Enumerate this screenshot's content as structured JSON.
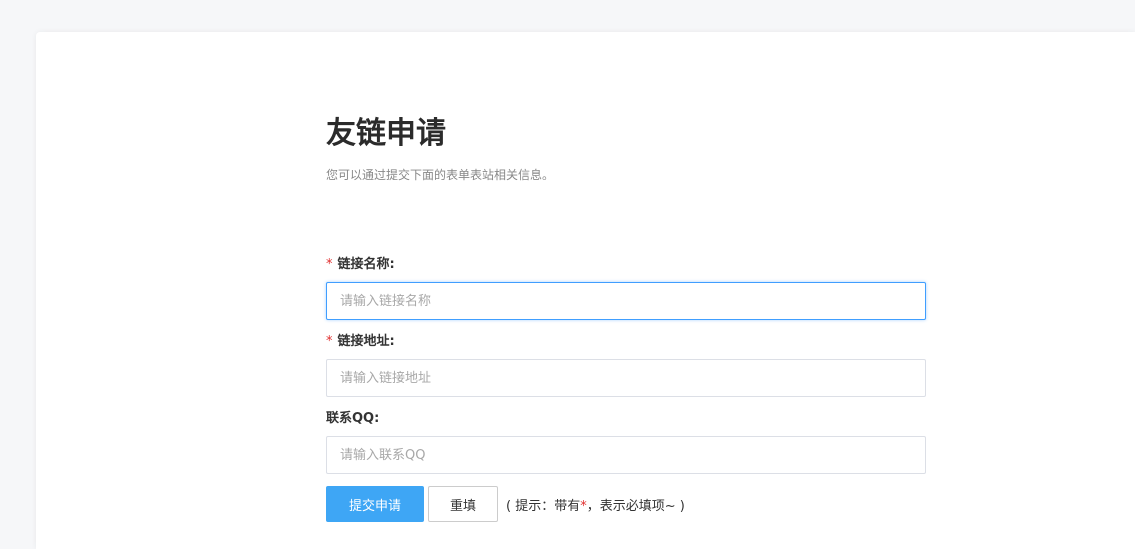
{
  "page": {
    "title": "友链申请",
    "subtitle": "您可以通过提交下面的表单表站相关信息。"
  },
  "form": {
    "required_mark": "*",
    "fields": [
      {
        "label": "链接名称:",
        "placeholder": "请输入链接名称",
        "value": "",
        "required": true
      },
      {
        "label": "链接地址:",
        "placeholder": "请输入链接地址",
        "value": "",
        "required": true
      },
      {
        "label": "联系QQ:",
        "placeholder": "请输入联系QQ",
        "value": "",
        "required": false
      }
    ],
    "submit_label": "提交申请",
    "reset_label": "重填",
    "hint_before": "( 提示：带有",
    "hint_star": "*",
    "hint_after": "，表示必填项~ )"
  },
  "colors": {
    "primary": "#3ea6f5",
    "required": "#e02d2d",
    "focus_border": "#409eff"
  }
}
